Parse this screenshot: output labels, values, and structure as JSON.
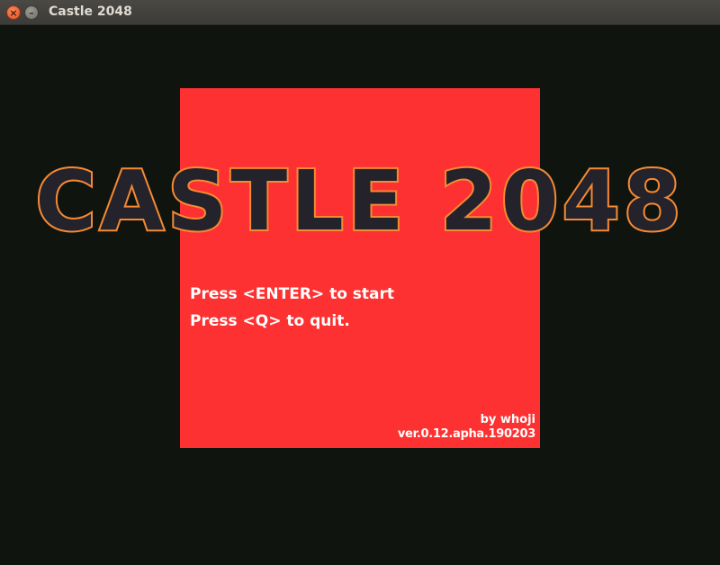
{
  "window": {
    "title": "Castle 2048",
    "close_glyph": "×",
    "minimize_glyph": "–"
  },
  "game": {
    "title": "CASTLE 2048",
    "instructions": [
      "Press <ENTER> to start",
      "Press <Q> to quit."
    ],
    "author": "by whoji",
    "version": "ver.0.12.apha.190203"
  },
  "colors": {
    "background": "#0f140f",
    "panel": "#fd3131",
    "title_fill": "#24222b",
    "title_outline": "#f58a34",
    "text": "#ffffff"
  }
}
